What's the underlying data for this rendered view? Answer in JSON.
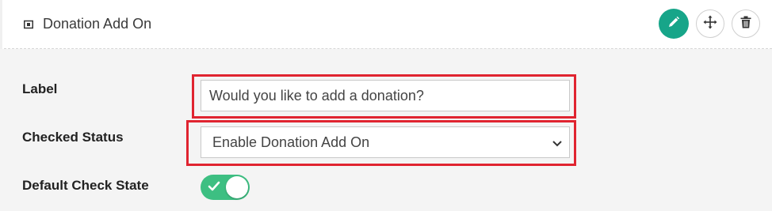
{
  "header": {
    "title": "Donation Add On",
    "icon": "money-bill-icon",
    "actions": [
      {
        "name": "edit",
        "icon": "pencil-icon",
        "color": "#17a589"
      },
      {
        "name": "move",
        "icon": "move-arrows-icon"
      },
      {
        "name": "delete",
        "icon": "trash-icon"
      }
    ]
  },
  "form": {
    "label_field": {
      "label": "Label",
      "value": "Would you like to add a donation?"
    },
    "checked_status": {
      "label": "Checked Status",
      "selected": "Enable Donation Add On"
    },
    "default_check_state": {
      "label": "Default Check State",
      "on": true
    }
  },
  "colors": {
    "accent": "#17a589",
    "toggle_on": "#3dbf82",
    "highlight": "#e02430"
  }
}
